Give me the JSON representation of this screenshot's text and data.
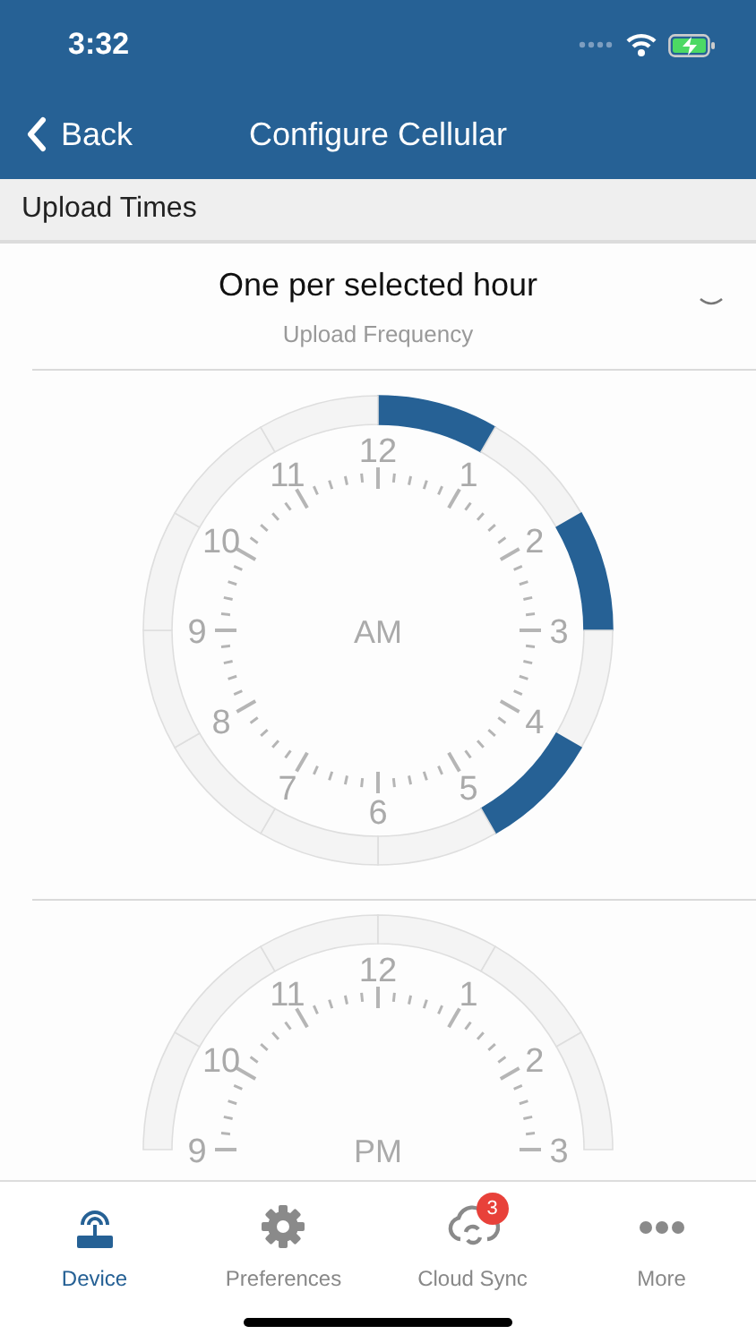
{
  "status_bar": {
    "time": "3:32"
  },
  "nav": {
    "back": "Back",
    "title": "Configure Cellular"
  },
  "section": {
    "title": "Upload Times"
  },
  "frequency": {
    "value": "One per selected hour",
    "label": "Upload Frequency"
  },
  "clocks": [
    {
      "period": "AM",
      "hours": [
        {
          "label": "12",
          "selected": true
        },
        {
          "label": "1",
          "selected": false
        },
        {
          "label": "2",
          "selected": true
        },
        {
          "label": "3",
          "selected": false
        },
        {
          "label": "4",
          "selected": true
        },
        {
          "label": "5",
          "selected": false
        },
        {
          "label": "6",
          "selected": false
        },
        {
          "label": "7",
          "selected": false
        },
        {
          "label": "8",
          "selected": false
        },
        {
          "label": "9",
          "selected": false
        },
        {
          "label": "10",
          "selected": false
        },
        {
          "label": "11",
          "selected": false
        }
      ]
    },
    {
      "period": "PM",
      "hours": [
        {
          "label": "9",
          "selected": false
        },
        {
          "label": "10",
          "selected": false
        },
        {
          "label": "11",
          "selected": false
        },
        {
          "label": "12",
          "selected": false
        },
        {
          "label": "1",
          "selected": false
        },
        {
          "label": "2",
          "selected": false
        },
        {
          "label": "3"
        }
      ]
    }
  ],
  "tabs": [
    {
      "label": "Device",
      "kind": "device",
      "selected": true
    },
    {
      "label": "Preferences",
      "kind": "gear",
      "selected": false
    },
    {
      "label": "Cloud Sync",
      "kind": "sync",
      "selected": false,
      "badge": "3"
    },
    {
      "label": "More",
      "kind": "more",
      "selected": false
    }
  ]
}
